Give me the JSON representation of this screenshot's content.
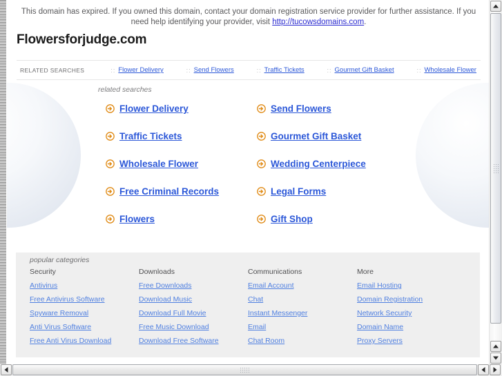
{
  "banner": {
    "text_before": "This domain has expired. If you owned this domain, contact your domain registration service provider for further assistance. If you need help identifying your provider, visit ",
    "link": "http://tucowsdomains.com",
    "text_after": "."
  },
  "domain": {
    "title": "Flowersforjudge.com"
  },
  "nav": {
    "label": "RELATED SEARCHES",
    "separator": "::",
    "links": [
      "Flower Delivery",
      "Send Flowers",
      "Traffic Tickets",
      "Gourmet Gift Basket",
      "Wholesale Flower"
    ]
  },
  "main": {
    "caption": "related searches",
    "arrow_icon": "circle-arrow-right-icon",
    "links_left": [
      "Flower Delivery",
      "Traffic Tickets",
      "Wholesale Flower",
      "Free Criminal Records",
      "Flowers"
    ],
    "links_right": [
      "Send Flowers",
      "Gourmet Gift Basket",
      "Wedding Centerpiece",
      "Legal Forms",
      "Gift Shop"
    ]
  },
  "categories": {
    "caption": "popular categories",
    "columns": [
      {
        "head": "Security",
        "links": [
          "Antivirus",
          "Free Antivirus Software",
          "Spyware Removal",
          "Anti Virus Software",
          "Free Anti Virus Download"
        ]
      },
      {
        "head": "Downloads",
        "links": [
          "Free Downloads",
          "Download Music",
          "Download Full Movie",
          "Free Music Download",
          "Download Free Software"
        ]
      },
      {
        "head": "Communications",
        "links": [
          "Email Account",
          "Chat",
          "Instant Messenger",
          "Email",
          "Chat Room"
        ]
      },
      {
        "head": "More",
        "links": [
          "Email Hosting",
          "Domain Registration",
          "Network Security",
          "Domain Name",
          "Proxy Servers"
        ]
      }
    ]
  },
  "colors": {
    "link_blue": "#2b57d8",
    "arrow_orange": "#e08a14",
    "panel_grey": "#efefef",
    "banner_text": "#59595b"
  }
}
